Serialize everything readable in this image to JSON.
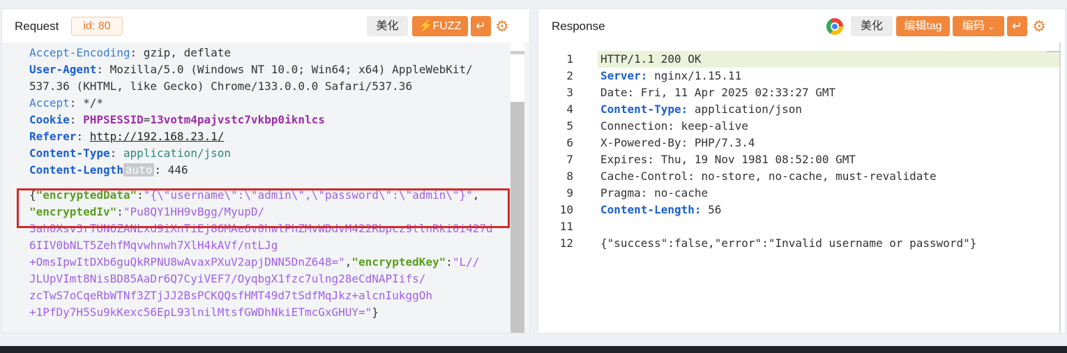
{
  "request": {
    "title": "Request",
    "id_badge": "id: 80",
    "beautify_label": "美化",
    "fuzz_label": "FUZZ",
    "headers": {
      "partial_line": "  ",
      "accept_encoding_key": "Accept-Encoding",
      "accept_encoding_val": "gzip, deflate",
      "user_agent_key": "User-Agent",
      "user_agent_val1": "Mozilla/5.0 (Windows NT 10.0; Win64; x64) AppleWebKit/",
      "user_agent_val2": "537.36 (KHTML, like Gecko) Chrome/133.0.0.0 Safari/537.36",
      "accept_key": "Accept",
      "accept_val": "*/*",
      "cookie_key": "Cookie",
      "cookie_name": "PHPSESSID",
      "cookie_eq": "=",
      "cookie_val": "13votm4pajvstc7vkbp0iknlcs",
      "referer_key": "Referer",
      "referer_val": "http://192.168.23.1/",
      "content_type_key": "Content-Type",
      "content_type_val": "application/json",
      "content_length_key": "Content-Length",
      "content_length_chip": "auto",
      "content_length_val": "446"
    },
    "body": {
      "l1_open": "{",
      "l1_key": "\"encryptedData\"",
      "l1_colon": ":",
      "l1_val": "\"{\\\"username\\\":\\\"admin\\\",\\\"password\\\":\\\"admin\\\"}\"",
      "l1_comma": ",",
      "l2_key": "\"encryptedIv\"",
      "l2_colon": ":",
      "l2_val": "\"Pu8QY1HH9vBgg/MyupD/",
      "l3": "3ah0Xsv3rTUN6ZANLxd9iXnTiEj86MAe6v0hwlPhZMvWDdvM422Rbpcz9tlnRki0i427d",
      "l4": "6IIV0bNLT5ZehfMqvwhnwh7XlH4kAVf/ntLJg",
      "l5_val": "+OmsIpwItDXb6guQkRPNU8wAvaxPXuV2apjDNN5DnZ648=\"",
      "l5_comma": ",",
      "l5_key": "\"encryptedKey\"",
      "l5_colon": ":",
      "l5_val2": "\"L//",
      "l6": "JLUpVImt8NisBD85AaDr6Q7CyiVEF7/OyqbgX1fzc7ulng28eCdNAPIifs/",
      "l7": "zcTwS7oCqeRbWTNf3ZTjJJ2BsPCKQQsfHMT49d7tSdfMqJkz+alcnIukggOh",
      "l8_val": "+1PfDy7H5Su9kKexc56EpL93lnilMtsfGWDhNkiETmcGxGHUY=\"",
      "l8_close": "}"
    }
  },
  "response": {
    "title": "Response",
    "beautify_label": "美化",
    "edit_tag_label": "编辑tag",
    "encoding_label": "编码",
    "lines": [
      {
        "n": "1",
        "key": "",
        "text": "HTTP/1.1 200 OK"
      },
      {
        "n": "2",
        "key": "Server:",
        "text": " nginx/1.15.11"
      },
      {
        "n": "3",
        "key": "",
        "text": "Date: Fri, 11 Apr 2025 02:33:27 GMT"
      },
      {
        "n": "4",
        "key": "Content-Type:",
        "text": " application/json"
      },
      {
        "n": "5",
        "key": "",
        "text": "Connection: keep-alive"
      },
      {
        "n": "6",
        "key": "",
        "text": "X-Powered-By: PHP/7.3.4"
      },
      {
        "n": "7",
        "key": "",
        "text": "Expires: Thu, 19 Nov 1981 08:52:00 GMT"
      },
      {
        "n": "8",
        "key": "",
        "text": "Cache-Control: no-store, no-cache, must-revalidate"
      },
      {
        "n": "9",
        "key": "",
        "text": "Pragma: no-cache"
      },
      {
        "n": "10",
        "key": "Content-Length:",
        "text": " 56"
      },
      {
        "n": "11",
        "key": "",
        "text": ""
      },
      {
        "n": "12",
        "key": "",
        "text": "{\"success\":false,\"error\":\"Invalid username or password\"}"
      }
    ]
  },
  "icons": {
    "fuzz": "lightning-icon",
    "wrap": "wrap-icon",
    "settings": "gear-icon",
    "browser": "chrome-icon",
    "dropdown": "chevron-down-icon"
  },
  "colors": {
    "accent_orange": "#f1873a",
    "highlight_red": "#d62828",
    "json_key_green": "#5a9e20",
    "json_string_purple": "#a060e8",
    "header_key_blue": "#1a5fd1"
  }
}
